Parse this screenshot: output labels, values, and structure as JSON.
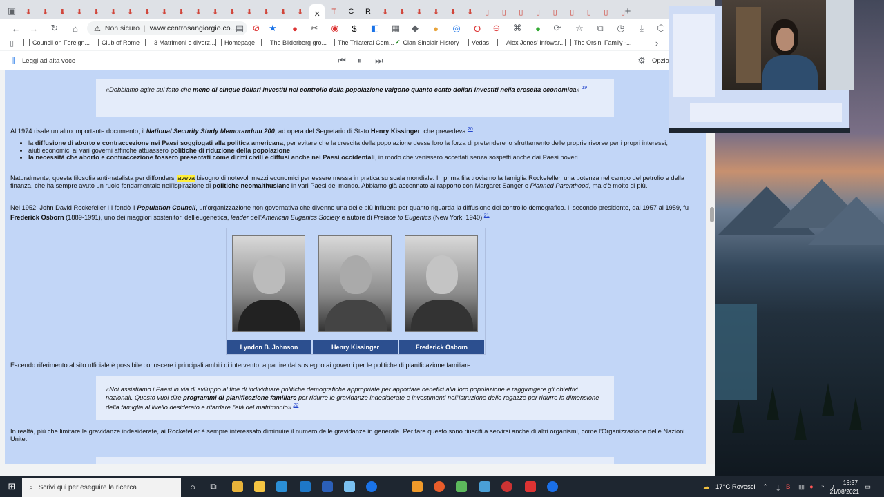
{
  "browser": {
    "url_security": "Non sicuro",
    "url": "www.centrosangiorgio.co...",
    "tab_count": 36
  },
  "bookmarks": [
    "Council on Foreign...",
    "Club of Rome",
    "3 Matrimoni e divorz...",
    "Homepage",
    "The Bilderberg gro...",
    "The Trilateral Com...",
    "Clan Sinclair History",
    "Vedas",
    "Alex Jones' Infowar...",
    "The Orsini Family -..."
  ],
  "readbar": {
    "read_aloud": "Leggi ad alta voce",
    "options": "Opzio"
  },
  "article": {
    "quote1_pre": "«Dobbiamo agire sul fatto che ",
    "quote1_bold": "meno di cinque dollari investiti nel controllo della popolazione valgono quanto cento dollari investiti nella crescita economica",
    "quote1_post": "» ",
    "quote1_ref": "19",
    "para1_pre": "Al 1974 risale un altro importante documento, il ",
    "para1_bold": "National Security Study Memorandum 200",
    "para1_mid": ", ad opera del Segretario di Stato ",
    "para1_name": "Henry Kissinger",
    "para1_post": ", che prevedeva ",
    "para1_ref": "20",
    "b1_pre": "la ",
    "b1_bold": "diffusione di aborto e contraccezione nei Paesi soggiogati alla politica americana",
    "b1_post": ", per evitare che la crescita della popolazione desse loro la forza di pretendere lo sfruttamento delle proprie risorse per i propri interessi;",
    "b2_pre": "aiuti economici ai vari governi affinché attuassero ",
    "b2_bold": "politiche di riduzione della popolazione",
    "b2_post": ";",
    "b3_bold": "la necessità che aborto e contraccezione fossero presentati come diritti civili e diffusi anche nei Paesi occidentali",
    "b3_post": ", in modo che venissero accettati senza sospetti anche dai Paesi poveri.",
    "para2_a": "Naturalmente, questa filosofia anti-natalista per diffondersi ",
    "para2_hl": "aveva",
    "para2_b": " bisogno di notevoli mezzi economici per essere messa in pratica su scala mondiale. In prima fila troviamo la famiglia Rockefeller, una potenza nel campo del petrolio e della finanza, che ha sempre avuto un ruolo fondamentale nell'ispirazione di ",
    "para2_bold": "politiche neomalthusiane",
    "para2_c": " in vari Paesi del mondo. Abbiamo già accennato al rapporto con Margaret Sanger e ",
    "para2_it": "Planned Parenthood",
    "para2_d": ", ma c'è molto di più.",
    "para3_a": "Nel 1952, John David Rockefeller III fondò il ",
    "para3_bold": "Population Council",
    "para3_b": ", un'organizzazione non governativa che divenne una delle più influenti per quanto riguarda la diffusione del controllo demografico. Il secondo presidente, dal 1957 al 1959, fu ",
    "para3_name": "Frederick Osborn",
    "para3_c": " (1889-1991), uno dei maggiori sostenitori dell'eugenetica, ",
    "para3_it1": "leader",
    "para3_d": " dell'",
    "para3_it2": "American Eugenics Society",
    "para3_e": " e autore di ",
    "para3_it3": "Preface to Eugenics",
    "para3_f": " (New York, 1940) ",
    "para3_ref": "21",
    "photo_captions": [
      "Lyndon B. Johnson",
      "Henry Kissinger",
      "Frederick Osborn"
    ],
    "para4": "Facendo riferimento al sito ufficiale è possibile conoscere i principali ambiti di intervento, a partire dal sostegno ai governi per le politiche di pianificazione familiare:",
    "quote2_a": "«Noi assistiamo i Paesi in via di sviluppo al fine di individuare politiche demografiche appropriate per apportare benefici alla loro popolazione e raggiungere gli obiettivi nazionali. Questo vuol dire ",
    "quote2_bold": "programmi di pianificazione familiare",
    "quote2_b": " per ridurre le gravidanze indesiderate e investimenti nell'istruzione delle ragazze per ridurre la dimensione della famiglia al livello desiderato e ritardare l'età del matrimonio» ",
    "quote2_ref": "22",
    "para5": "In realtà, più che limitare le gravidanze indesiderate, ai Rockefeller è sempre interessato diminuire il numero delle gravidanze in generale. Per fare questo sono riusciti a servirsi anche di altri organismi, come l'Organizzazione delle Nazioni Unite."
  },
  "taskbar": {
    "search_placeholder": "Scrivi qui per eseguire la ricerca",
    "weather": "17°C  Rovesci",
    "time": "16:37",
    "date": "21/08/2021"
  }
}
